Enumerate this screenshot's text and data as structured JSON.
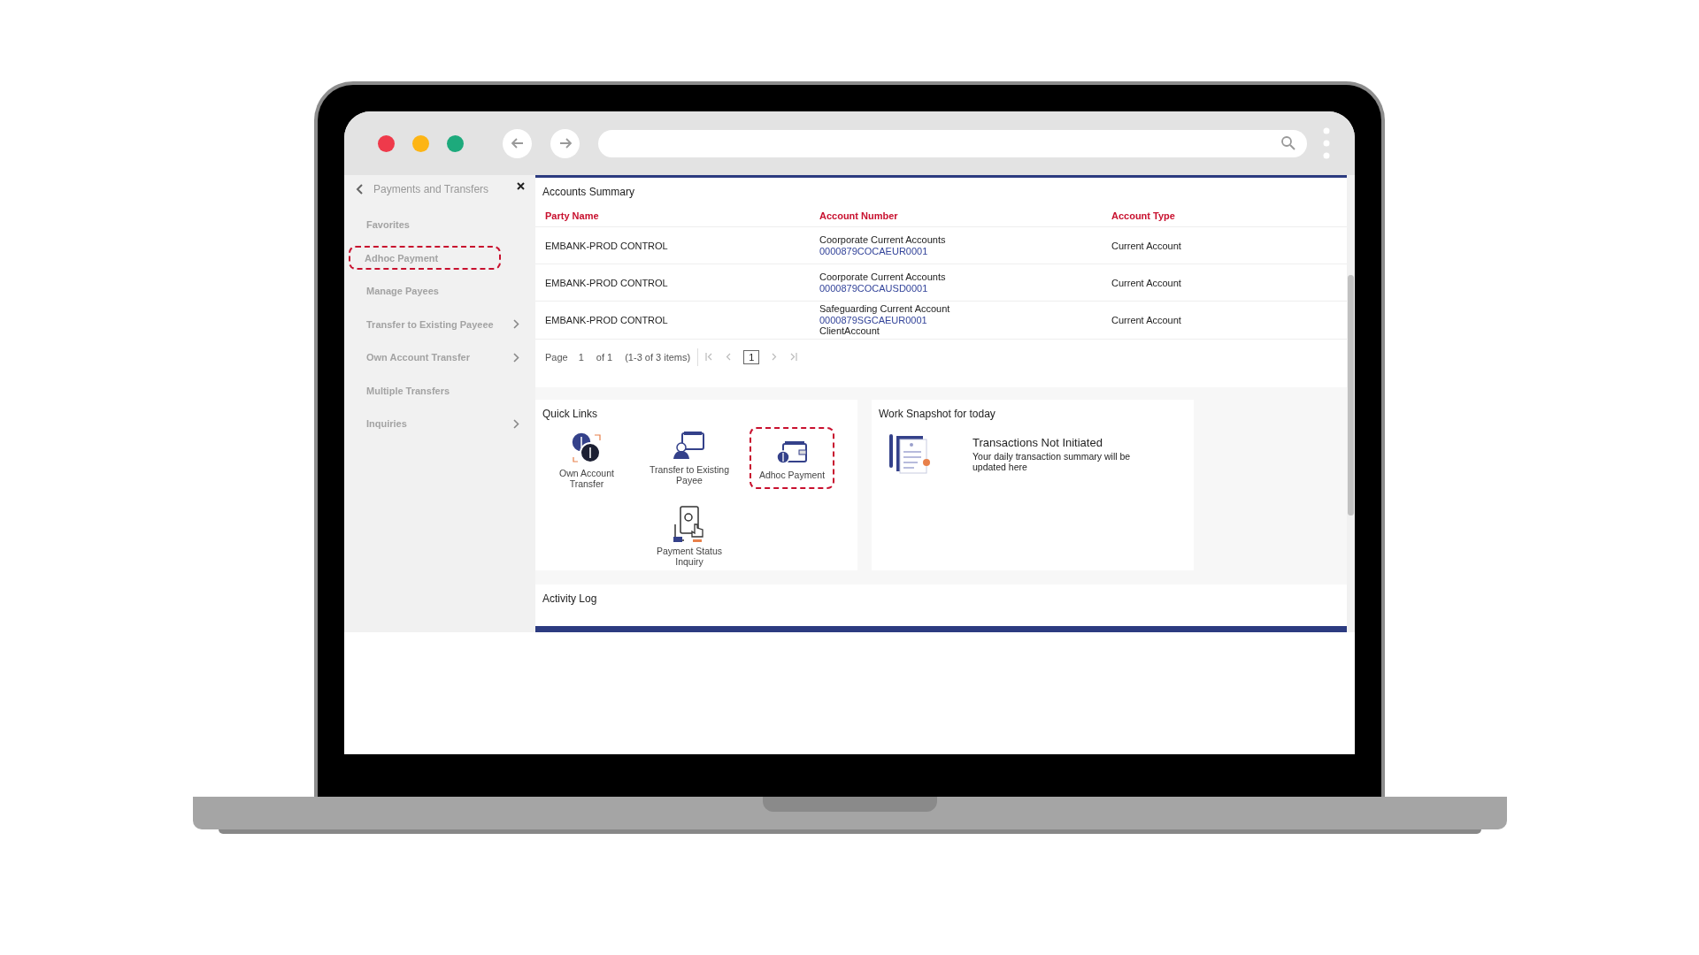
{
  "sidebar": {
    "title": "Payments and Transfers",
    "items": [
      {
        "label": "Favorites",
        "has_submenu": false,
        "highlighted": false
      },
      {
        "label": "Adhoc Payment",
        "has_submenu": false,
        "highlighted": true
      },
      {
        "label": "Manage Payees",
        "has_submenu": false,
        "highlighted": false
      },
      {
        "label": "Transfer to Existing Payeee",
        "has_submenu": true,
        "highlighted": false
      },
      {
        "label": "Own Account Transfer",
        "has_submenu": true,
        "highlighted": false
      },
      {
        "label": "Multiple Transfers",
        "has_submenu": false,
        "highlighted": false
      },
      {
        "label": "Inquiries",
        "has_submenu": true,
        "highlighted": false
      }
    ]
  },
  "accounts_summary": {
    "title": "Accounts Summary",
    "columns": [
      "Party Name",
      "Account Number",
      "Account Type"
    ],
    "rows": [
      {
        "party_name": "EMBANK-PROD CONTROL",
        "account_name": "Coorporate Current Accounts",
        "account_number": "0000879COCAEUR0001",
        "account_type": "Current Account"
      },
      {
        "party_name": "EMBANK-PROD CONTROL",
        "account_name": "Coorporate Current Accounts",
        "account_number": "0000879COCAUSD0001",
        "account_type": "Current Account"
      },
      {
        "party_name": "EMBANK-PROD CONTROL",
        "account_name": "Safeguarding Current Account",
        "account_number": "0000879SGCAEUR0001",
        "account_note": "ClientAccount",
        "account_type": "Current Account"
      }
    ],
    "pagination": {
      "page_label": "Page",
      "page": "1",
      "of": "of 1",
      "items": "(1-3 of 3 items)",
      "pages": [
        {
          "label": "1",
          "selected": true
        }
      ]
    }
  },
  "quick_links": {
    "title": "Quick Links",
    "items": [
      {
        "label": "Own Account Transfer",
        "kind": "exchange",
        "highlighted": false
      },
      {
        "label": "Transfer to Existing Payee",
        "kind": "payee",
        "highlighted": false
      },
      {
        "label": "Adhoc Payment",
        "kind": "wallet",
        "highlighted": true
      },
      {
        "label": "Payment Status Inquiry",
        "kind": "inquiry",
        "highlighted": false
      }
    ]
  },
  "work_snapshot": {
    "title": "Work Snapshot for today",
    "heading": "Transactions Not Initiated",
    "text": "Your daily transaction summary will be updated here"
  },
  "activity_log": {
    "title": "Activity Log"
  }
}
